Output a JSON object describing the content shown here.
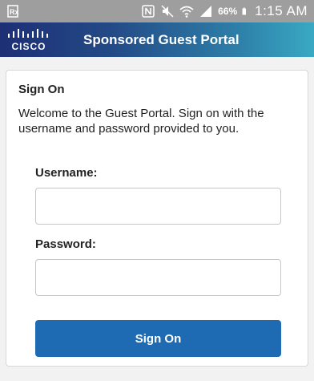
{
  "status_bar": {
    "battery_percent": "66%",
    "time": "1:15 AM",
    "icons": [
      "notification-icon",
      "nfc-icon",
      "mute-icon",
      "wifi-icon",
      "signal-icon",
      "battery-icon"
    ]
  },
  "header": {
    "logo_text": "CISCO",
    "title": "Sponsored Guest Portal"
  },
  "signon": {
    "title": "Sign On",
    "welcome": "Welcome to the Guest Portal. Sign on with the username and password provided to you.",
    "username_label": "Username:",
    "username_value": "",
    "password_label": "Password:",
    "password_value": "",
    "button_label": "Sign On"
  },
  "colors": {
    "header_gradient_start": "#1d2f75",
    "header_gradient_end": "#39a9c3",
    "button": "#1e6bb3",
    "status_bar": "#9e9e9e"
  }
}
